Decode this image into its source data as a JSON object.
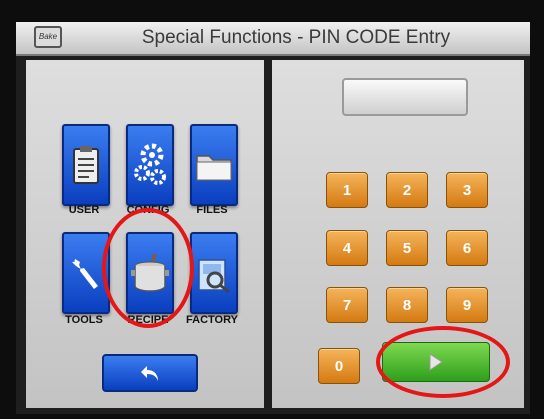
{
  "header": {
    "title": "Special Functions - PIN CODE Entry",
    "logo_text": "Bake"
  },
  "functions": [
    {
      "label": "USER",
      "icon": "clipboard-icon"
    },
    {
      "label": "CONFIG",
      "icon": "gears-icon"
    },
    {
      "label": "FILES",
      "icon": "folder-icon"
    },
    {
      "label": "TOOLS",
      "icon": "wrench-icon"
    },
    {
      "label": "RECIPE",
      "icon": "cooking-pot-icon"
    },
    {
      "label": "FACTORY",
      "icon": "factory-icon"
    }
  ],
  "back_button": {
    "icon": "return-arrow-icon"
  },
  "pin": {
    "value": ""
  },
  "keypad": [
    "1",
    "2",
    "3",
    "4",
    "5",
    "6",
    "7",
    "8",
    "9",
    "0"
  ],
  "enter_button": {
    "icon": "play-arrow-icon"
  },
  "colors": {
    "tile_blue": "#0a3fbf",
    "key_orange": "#e8921f",
    "enter_green": "#3fb52a",
    "highlight_red": "#e41616"
  }
}
